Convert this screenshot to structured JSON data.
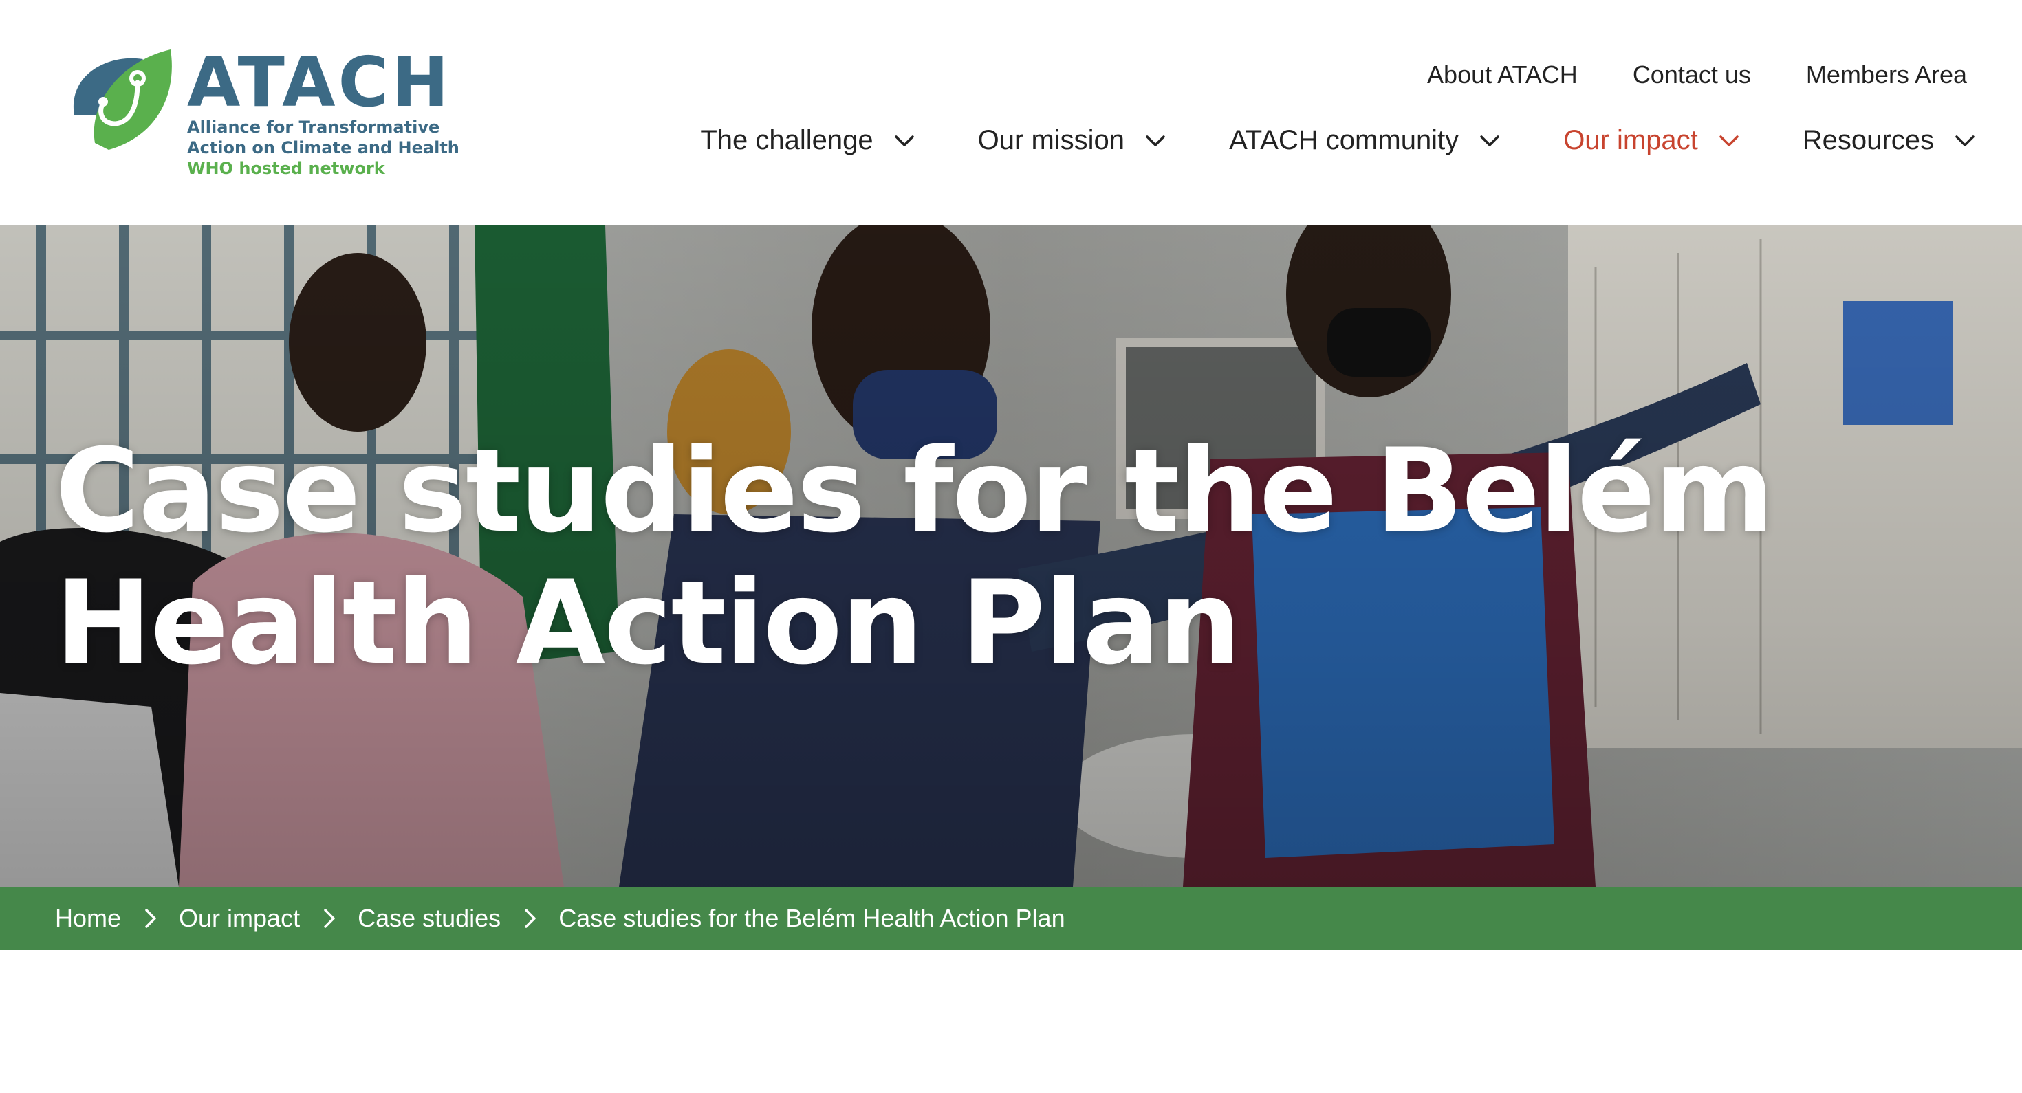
{
  "logo": {
    "wordmark": "ATACH",
    "tagline_line1": "Alliance for Transformative",
    "tagline_line2": "Action on Climate and Health",
    "tagline_line3": "WHO hosted network",
    "mark_icon": "leaf-stethoscope-icon",
    "colors": {
      "blue": "#3c6a85",
      "green": "#5ab04d"
    }
  },
  "top_links": [
    "About ATACH",
    "Contact us",
    "Members Area"
  ],
  "main_nav": [
    {
      "label": "The challenge",
      "active": false
    },
    {
      "label": "Our mission",
      "active": false
    },
    {
      "label": "ATACH community",
      "active": false
    },
    {
      "label": "Our impact",
      "active": true
    },
    {
      "label": "Resources",
      "active": false
    }
  ],
  "hero": {
    "title": "Case studies for the Belém Health Action Plan"
  },
  "breadcrumb": [
    "Home",
    "Our impact",
    "Case studies",
    "Case studies for the Belém Health Action Plan"
  ],
  "colors": {
    "accent_active": "#c8442f",
    "breadcrumb_bg": "#45884a",
    "text": "#222222"
  }
}
